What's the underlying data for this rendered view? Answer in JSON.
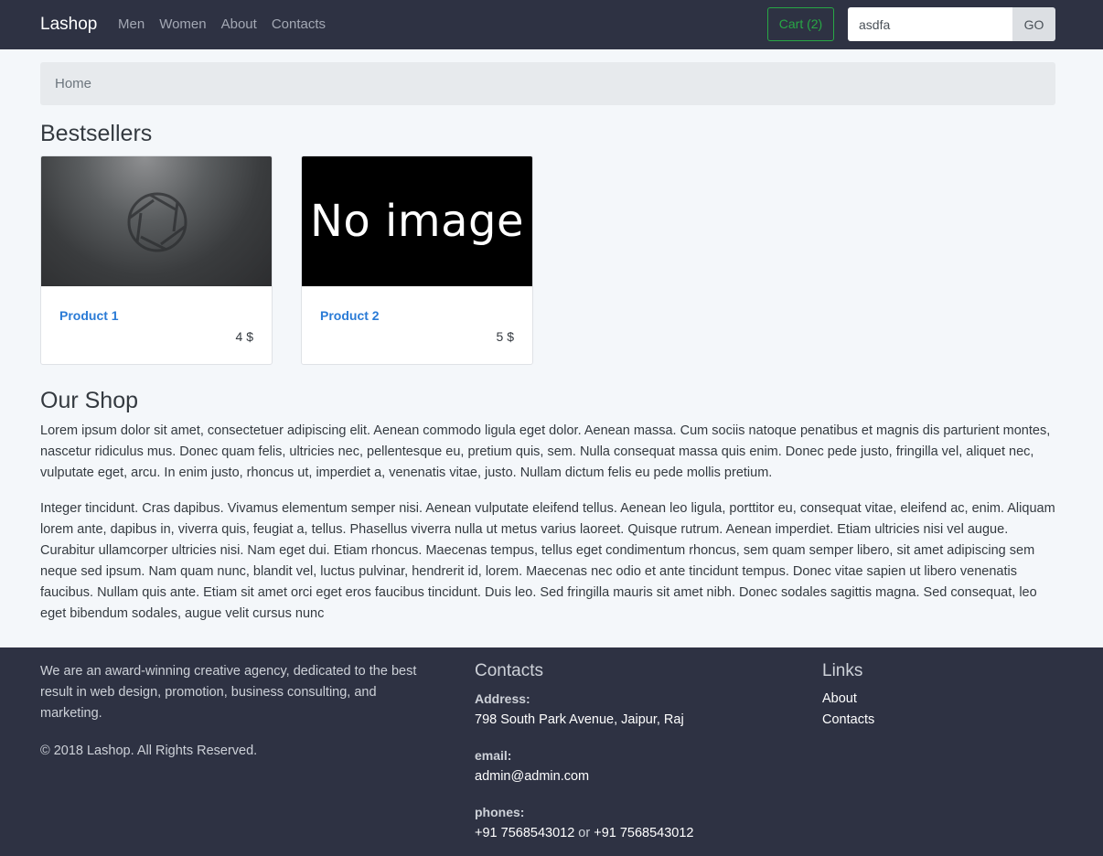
{
  "nav": {
    "brand": "Lashop",
    "links": [
      "Men",
      "Women",
      "About",
      "Contacts"
    ],
    "cart_label": "Cart (2)",
    "search_value": "asdfa",
    "search_button": "GO"
  },
  "breadcrumb": {
    "home": "Home"
  },
  "bestsellers": {
    "title": "Bestsellers",
    "products": [
      {
        "name": "Product 1",
        "price": "4 $",
        "image": "camera-shutter-photo"
      },
      {
        "name": "Product 2",
        "price": "5 $",
        "image_text": "No image"
      }
    ]
  },
  "shop": {
    "title": "Our Shop",
    "paragraphs": [
      "Lorem ipsum dolor sit amet, consectetuer adipiscing elit. Aenean commodo ligula eget dolor. Aenean massa. Cum sociis natoque penatibus et magnis dis parturient montes, nascetur ridiculus mus. Donec quam felis, ultricies nec, pellentesque eu, pretium quis, sem. Nulla consequat massa quis enim. Donec pede justo, fringilla vel, aliquet nec, vulputate eget, arcu. In enim justo, rhoncus ut, imperdiet a, venenatis vitae, justo. Nullam dictum felis eu pede mollis pretium.",
      "Integer tincidunt. Cras dapibus. Vivamus elementum semper nisi. Aenean vulputate eleifend tellus. Aenean leo ligula, porttitor eu, consequat vitae, eleifend ac, enim. Aliquam lorem ante, dapibus in, viverra quis, feugiat a, tellus. Phasellus viverra nulla ut metus varius laoreet. Quisque rutrum. Aenean imperdiet. Etiam ultricies nisi vel augue. Curabitur ullamcorper ultricies nisi. Nam eget dui. Etiam rhoncus. Maecenas tempus, tellus eget condimentum rhoncus, sem quam semper libero, sit amet adipiscing sem neque sed ipsum. Nam quam nunc, blandit vel, luctus pulvinar, hendrerit id, lorem. Maecenas nec odio et ante tincidunt tempus. Donec vitae sapien ut libero venenatis faucibus. Nullam quis ante. Etiam sit amet orci eget eros faucibus tincidunt. Duis leo. Sed fringilla mauris sit amet nibh. Donec sodales sagittis magna. Sed consequat, leo eget bibendum sodales, augue velit cursus nunc"
    ]
  },
  "footer": {
    "about": "We are an award-winning creative agency, dedicated to the best result in web design, promotion, business consulting, and marketing.",
    "copyright": "©  2018 Lashop. All Rights Reserved.",
    "contacts": {
      "title": "Contacts",
      "address_label": "Address:",
      "address": "798 South Park Avenue, Jaipur, Raj",
      "email_label": "email:",
      "email": "admin@admin.com",
      "phones_label": "phones:",
      "phone_1": "+91 7568543012",
      "phone_sep": " or ",
      "phone_2": "+91 7568543012"
    },
    "links": {
      "title": "Links",
      "items": [
        "About",
        "Contacts"
      ]
    }
  },
  "colors": {
    "navbar_bg": "#2e3243",
    "page_bg": "#f4f7fa",
    "cart_green": "#28a745",
    "link_blue": "#2a7bd6"
  }
}
